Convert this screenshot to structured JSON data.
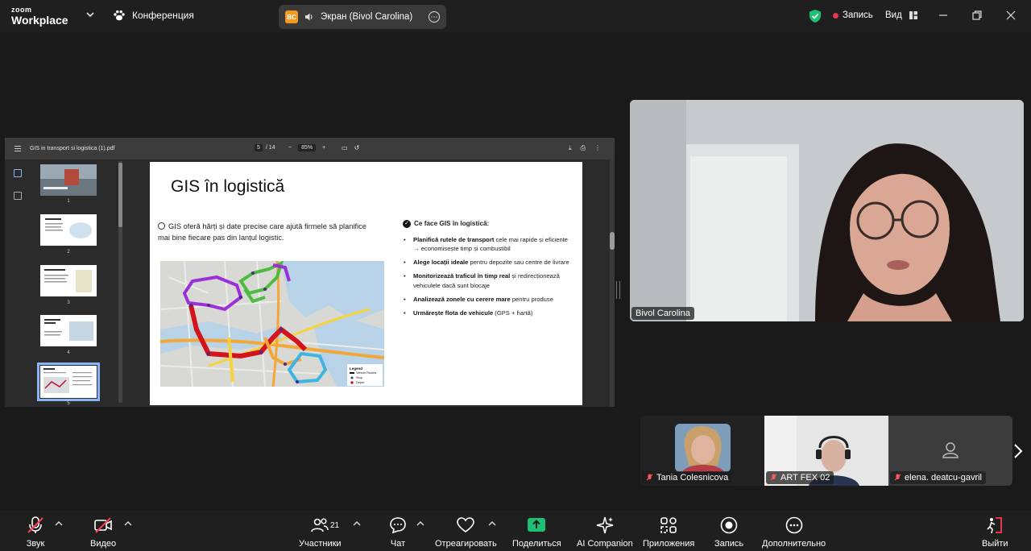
{
  "app": {
    "logo_line1": "zoom",
    "logo_line2": "Workplace"
  },
  "meeting": {
    "title": "Конференция"
  },
  "share": {
    "badge": "BC",
    "label": "Экран (Bivol Carolina)"
  },
  "top_right": {
    "record_label": "Запись",
    "view_label": "Вид"
  },
  "pdf": {
    "filename": "GIS in transport si logistica (1).pdf",
    "current_page": "5",
    "total_pages": "/ 14",
    "zoom": "85%",
    "zoom_minus": "−",
    "zoom_plus": "+",
    "thumbnails": [
      {
        "num": "1"
      },
      {
        "num": "2"
      },
      {
        "num": "3"
      },
      {
        "num": "4"
      },
      {
        "num": "5"
      }
    ]
  },
  "slide": {
    "title": "GIS în logistică",
    "intro": "GIS oferă hărți și date precise care ajută firmele să planifice mai bine fiecare pas din lanțul logistic.",
    "right_heading": "Ce face GIS în logistică:",
    "bullets": [
      {
        "bold": "Planifică rutele de transport",
        "rest": " cele mai rapide și eficiente",
        "sub": "→ economisește timp și combustibil"
      },
      {
        "bold": "Alege locații ideale",
        "rest": " pentru depozite sau centre de livrare",
        "sub": ""
      },
      {
        "bold": "Monitorizează traficul în timp real",
        "rest": " și redirecționează vehiculele dacă sunt blocaje",
        "sub": ""
      },
      {
        "bold": "Analizează zonele cu cerere mare",
        "rest": " pentru produse",
        "sub": ""
      },
      {
        "bold": "Urmărește flota de vehicule",
        "rest": " (GPS + hartă)",
        "sub": ""
      }
    ],
    "legend": {
      "title": "Legend",
      "routes": "Vehicle Routes",
      "stop": "Stop",
      "depot": "Depot"
    }
  },
  "speaker": {
    "name": "Bivol Carolina"
  },
  "gallery": [
    {
      "name": "Tania Colesnicova"
    },
    {
      "name": "ART FEX 02"
    },
    {
      "name": "elena. deatcu-gavril"
    }
  ],
  "toolbar": {
    "audio": "Звук",
    "video": "Видео",
    "participants": "Участники",
    "participants_count": "21",
    "chat": "Чат",
    "react": "Отреагировать",
    "share": "Поделиться",
    "ai": "AI Companion",
    "apps": "Приложения",
    "record": "Запись",
    "more": "Дополнительно",
    "leave": "Выйти"
  },
  "colors": {
    "background": "#1a1a1a",
    "share_green": "#1dbf73",
    "record_red": "#e8384f",
    "accent_blue": "#8ab4f8"
  }
}
